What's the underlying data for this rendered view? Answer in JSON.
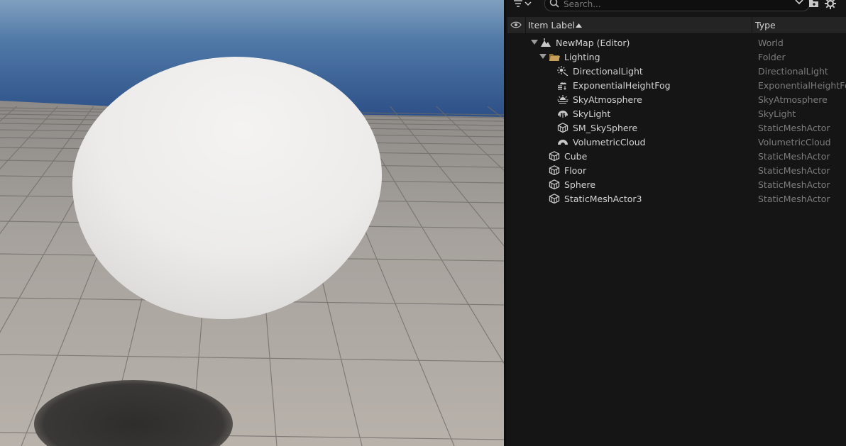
{
  "outliner": {
    "search_placeholder": "Search...",
    "columns": {
      "label": "Item Label",
      "type": "Type"
    },
    "rows": [
      {
        "label": "NewMap (Editor)",
        "type": "World",
        "icon": "world-icon"
      },
      {
        "label": "Lighting",
        "type": "Folder",
        "icon": "folder-icon"
      },
      {
        "label": "DirectionalLight",
        "type": "DirectionalLight",
        "icon": "directional-light-icon"
      },
      {
        "label": "ExponentialHeightFog",
        "type": "ExponentialHeightFog",
        "icon": "height-fog-icon"
      },
      {
        "label": "SkyAtmosphere",
        "type": "SkyAtmosphere",
        "icon": "sky-atmosphere-icon"
      },
      {
        "label": "SkyLight",
        "type": "SkyLight",
        "icon": "sky-light-icon"
      },
      {
        "label": "SM_SkySphere",
        "type": "StaticMeshActor",
        "icon": "static-mesh-icon"
      },
      {
        "label": "VolumetricCloud",
        "type": "VolumetricCloud",
        "icon": "volumetric-cloud-icon"
      },
      {
        "label": "Cube",
        "type": "StaticMeshActor",
        "icon": "static-mesh-icon"
      },
      {
        "label": "Floor",
        "type": "StaticMeshActor",
        "icon": "static-mesh-icon"
      },
      {
        "label": "Sphere",
        "type": "StaticMeshActor",
        "icon": "static-mesh-icon"
      },
      {
        "label": "StaticMeshActor3",
        "type": "StaticMeshActor",
        "icon": "static-mesh-icon"
      }
    ]
  },
  "colors": {
    "panel_bg": "#151515",
    "header_bg": "#242424",
    "folder": "#c8a05a",
    "sky_top": "#5f8ab4",
    "sky_horizon": "#2d4f86"
  }
}
